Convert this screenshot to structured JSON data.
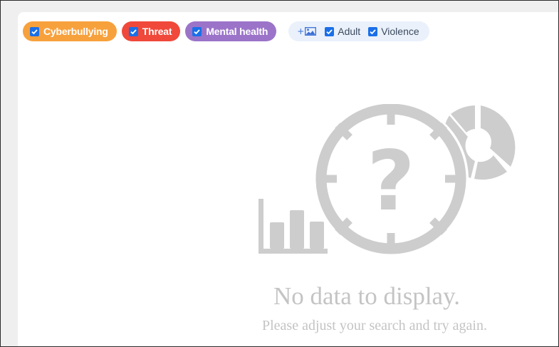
{
  "filters": {
    "chips": [
      {
        "label": "Cyberbullying",
        "checked": true,
        "color": "#f7a13d"
      },
      {
        "label": "Threat",
        "checked": true,
        "color": "#f0483a"
      },
      {
        "label": "Mental health",
        "checked": true,
        "color": "#9b74c9"
      }
    ],
    "media": {
      "add_icon": "add-image-icon",
      "options": [
        {
          "label": "Adult",
          "checked": true
        },
        {
          "label": "Violence",
          "checked": true
        }
      ]
    }
  },
  "empty_state": {
    "icon": "no-data-illustration",
    "title": "No data to display.",
    "subtitle": "Please adjust your search and try again."
  },
  "colors": {
    "checkbox": "#1a6fe8",
    "media_group_bg": "#eaf1fb",
    "empty_gray": "#c4c4c4",
    "illustration_gray": "#cdcdcd"
  }
}
